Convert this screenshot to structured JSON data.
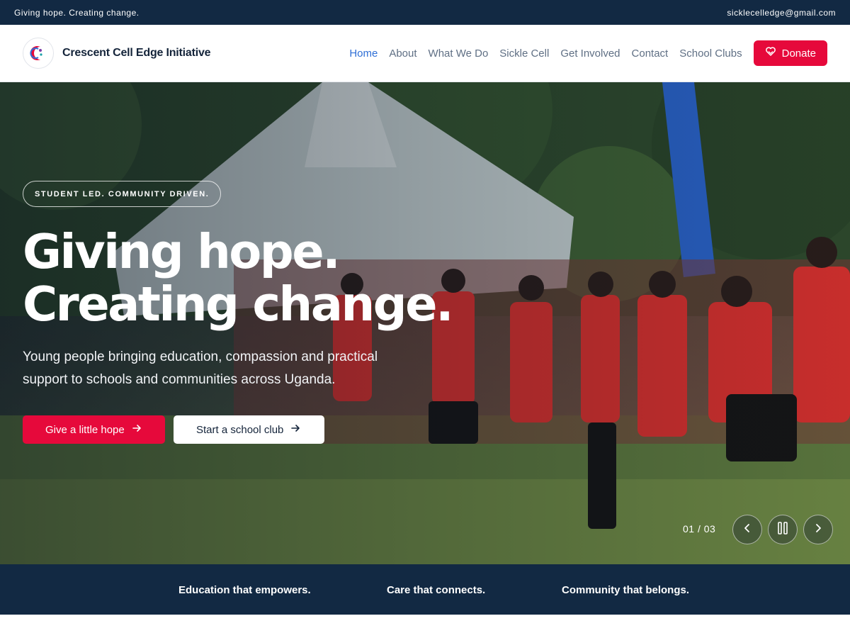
{
  "topbar": {
    "tagline": "Giving hope. Creating change.",
    "email": "sicklecelledge@gmail.com"
  },
  "header": {
    "brand_name": "Crescent Cell Edge Initiative",
    "logo_icon": "crescent-logo-icon",
    "nav": [
      {
        "label": "Home",
        "active": true
      },
      {
        "label": "About",
        "active": false
      },
      {
        "label": "What We Do",
        "active": false
      },
      {
        "label": "Sickle Cell",
        "active": false
      },
      {
        "label": "Get Involved",
        "active": false
      },
      {
        "label": "Contact",
        "active": false
      },
      {
        "label": "School Clubs",
        "active": false
      }
    ],
    "donate_label": "Donate",
    "donate_icon": "heart-hand-icon"
  },
  "hero": {
    "badge": "STUDENT LED. COMMUNITY DRIVEN.",
    "title": "Giving hope. Creating change.",
    "subtitle": "Young people bringing education, compassion and practical support to schools and communities across Uganda.",
    "cta_primary": "Give a little hope",
    "cta_secondary": "Start a school club",
    "slide_counter": "01 / 03"
  },
  "values": {
    "items": [
      "Education that empowers.",
      "Care that connects.",
      "Community that belongs."
    ]
  },
  "colors": {
    "navy": "#122943",
    "accent_red": "#e6093b",
    "link_active": "#2f6fd6",
    "nav_text": "#5f6f84"
  }
}
